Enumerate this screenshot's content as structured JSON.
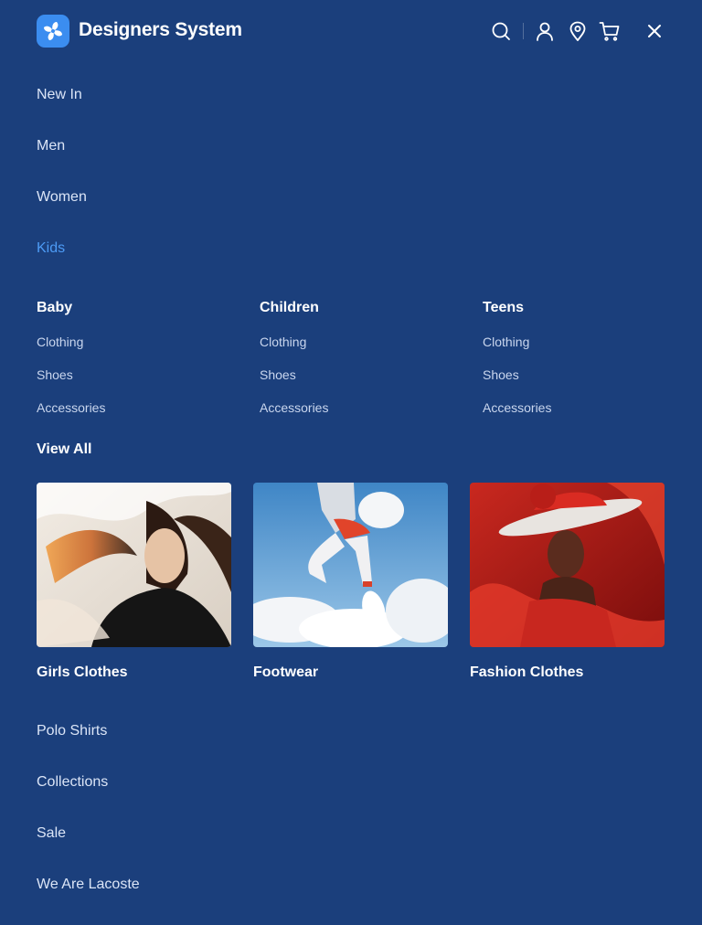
{
  "header": {
    "brand": "Designers System",
    "icons": [
      "logo-icon",
      "search-icon",
      "user-icon",
      "location-pin-icon",
      "cart-icon",
      "close-icon"
    ]
  },
  "nav_top": [
    {
      "label": "New In",
      "active": false
    },
    {
      "label": "Men",
      "active": false
    },
    {
      "label": "Women",
      "active": false
    },
    {
      "label": "Kids",
      "active": true
    }
  ],
  "submenu": {
    "columns": [
      {
        "title": "Baby",
        "links": [
          "Clothing",
          "Shoes",
          "Accessories"
        ]
      },
      {
        "title": "Children",
        "links": [
          "Clothing",
          "Shoes",
          "Accessories"
        ]
      },
      {
        "title": "Teens",
        "links": [
          "Clothing",
          "Shoes",
          "Accessories"
        ]
      }
    ],
    "view_all": "View All"
  },
  "cards": [
    {
      "label": "Girls Clothes"
    },
    {
      "label": "Footwear"
    },
    {
      "label": "Fashion Clothes"
    }
  ],
  "nav_bottom": [
    {
      "label": "Polo Shirts"
    },
    {
      "label": "Collections"
    },
    {
      "label": "Sale"
    },
    {
      "label": "We Are Lacoste"
    }
  ],
  "colors": {
    "background": "#1b3f7c",
    "accent": "#4d9bf5",
    "logo": "#3b8df0"
  }
}
